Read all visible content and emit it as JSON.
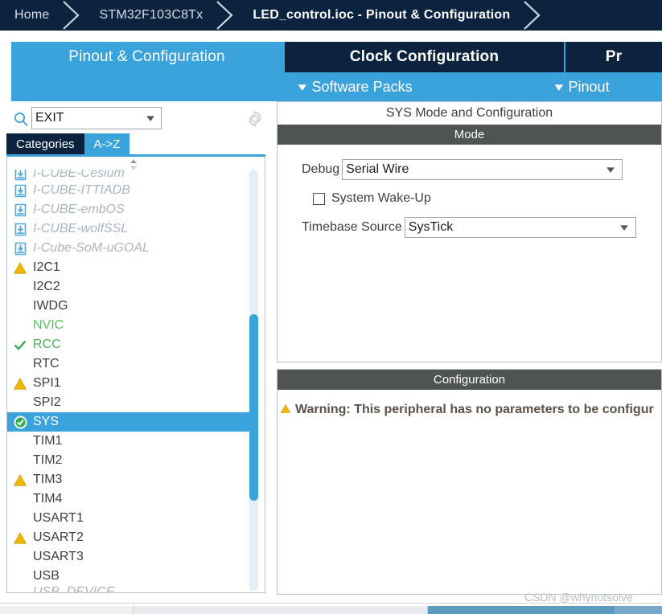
{
  "breadcrumb": {
    "items": [
      {
        "label": "Home",
        "active": false
      },
      {
        "label": "STM32F103C8Tx",
        "active": false
      },
      {
        "label": "LED_control.ioc - Pinout & Configuration",
        "active": true
      }
    ]
  },
  "tabs": [
    {
      "label": "Pinout & Configuration",
      "selected": true
    },
    {
      "label": "Clock Configuration",
      "selected": false
    },
    {
      "label": "Pr",
      "selected": false
    }
  ],
  "subtabs": [
    {
      "label": "Software Packs",
      "icon": "chevron-down-icon"
    },
    {
      "label": "Pinout",
      "icon": "chevron-down-icon"
    }
  ],
  "sidebar": {
    "search": {
      "value": "EXIT",
      "placeholder": "",
      "icon": "search-icon",
      "dropdown_icon": "chevron-down-icon"
    },
    "settings_icon": "gear-icon",
    "view_tabs": [
      {
        "label": "Categories",
        "selected": false
      },
      {
        "label": "A->Z",
        "selected": true
      }
    ],
    "scroll_spinner_icon": "scroll-updown-icon",
    "items": [
      {
        "label": "I-CUBE-Cesium",
        "icon": "download-icon",
        "state": "ghost",
        "clip": "top"
      },
      {
        "label": "I-CUBE-ITTIADB",
        "icon": "download-icon",
        "state": "ghost",
        "clip": ""
      },
      {
        "label": "I-CUBE-embOS",
        "icon": "download-icon",
        "state": "ghost",
        "clip": ""
      },
      {
        "label": "I-CUBE-wolfSSL",
        "icon": "download-icon",
        "state": "ghost",
        "clip": ""
      },
      {
        "label": "I-Cube-SoM-uGOAL",
        "icon": "download-icon",
        "state": "ghost",
        "clip": ""
      },
      {
        "label": "I2C1",
        "icon": "warning-icon",
        "state": "normal",
        "clip": ""
      },
      {
        "label": "I2C2",
        "icon": "",
        "state": "normal",
        "clip": ""
      },
      {
        "label": "IWDG",
        "icon": "",
        "state": "normal",
        "clip": ""
      },
      {
        "label": "NVIC",
        "icon": "",
        "state": "nvic",
        "clip": ""
      },
      {
        "label": "RCC",
        "icon": "check-icon",
        "state": "ok",
        "clip": ""
      },
      {
        "label": "RTC",
        "icon": "",
        "state": "normal",
        "clip": ""
      },
      {
        "label": "SPI1",
        "icon": "warning-icon",
        "state": "normal",
        "clip": ""
      },
      {
        "label": "SPI2",
        "icon": "",
        "state": "normal",
        "clip": ""
      },
      {
        "label": "SYS",
        "icon": "check-circle-icon",
        "state": "selected",
        "clip": ""
      },
      {
        "label": "TIM1",
        "icon": "",
        "state": "normal",
        "clip": ""
      },
      {
        "label": "TIM2",
        "icon": "",
        "state": "normal",
        "clip": ""
      },
      {
        "label": "TIM3",
        "icon": "warning-icon",
        "state": "normal",
        "clip": ""
      },
      {
        "label": "TIM4",
        "icon": "",
        "state": "normal",
        "clip": ""
      },
      {
        "label": "USART1",
        "icon": "",
        "state": "normal",
        "clip": ""
      },
      {
        "label": "USART2",
        "icon": "warning-icon",
        "state": "normal",
        "clip": ""
      },
      {
        "label": "USART3",
        "icon": "",
        "state": "normal",
        "clip": ""
      },
      {
        "label": "USB",
        "icon": "",
        "state": "normal",
        "clip": ""
      },
      {
        "label": "USB_DEVICE",
        "icon": "",
        "state": "ghost",
        "clip": "bot"
      }
    ]
  },
  "mode_panel": {
    "title": "SYS Mode and Configuration",
    "section_label": "Mode",
    "debug": {
      "label": "Debug",
      "value": "Serial Wire",
      "dropdown_icon": "chevron-down-icon"
    },
    "wakeup": {
      "label": "System Wake-Up",
      "checked": false
    },
    "timebase": {
      "label": "Timebase Source",
      "value": "SysTick",
      "dropdown_icon": "chevron-down-icon"
    }
  },
  "config_panel": {
    "section_label": "Configuration",
    "warning_icon": "warning-icon",
    "warning_text": "Warning: This peripheral has no parameters to be configur"
  },
  "watermark": {
    "text": "CSDN @whynotsolve"
  },
  "colors": {
    "navy": "#0c2340",
    "accent_blue": "#3aa3db",
    "section_grey": "#4f5354",
    "warn_yellow": "#f2b705",
    "ok_green": "#4caf50",
    "ghost_grey": "#a9b4bf"
  }
}
